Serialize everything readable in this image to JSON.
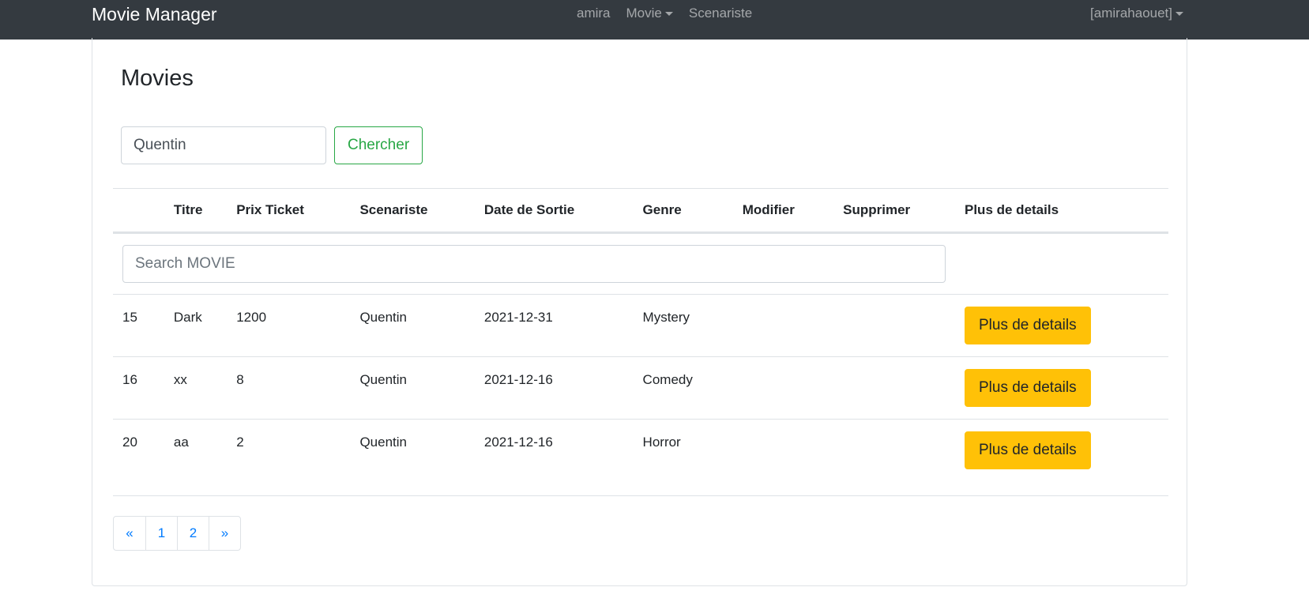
{
  "navbar": {
    "brand": "Movie Manager",
    "links": [
      "amira",
      "Movie",
      "Scenariste"
    ],
    "user": "[amirahaouet]"
  },
  "page": {
    "title": "Movies"
  },
  "search": {
    "value": "Quentin",
    "button_label": "Chercher"
  },
  "table": {
    "headers": [
      "",
      "Titre",
      "Prix Ticket",
      "Scenariste",
      "Date de Sortie",
      "Genre",
      "Modifier",
      "Supprimer",
      "Plus de details"
    ],
    "filter_placeholder": "Search MOVIE",
    "rows": [
      {
        "id": "15",
        "titre": "Dark",
        "prix": "1200",
        "scenariste": "Quentin",
        "date": "2021-12-31",
        "genre": "Mystery",
        "details_label": "Plus de details"
      },
      {
        "id": "16",
        "titre": "xx",
        "prix": "8",
        "scenariste": "Quentin",
        "date": "2021-12-16",
        "genre": "Comedy",
        "details_label": "Plus de details"
      },
      {
        "id": "20",
        "titre": "aa",
        "prix": "2",
        "scenariste": "Quentin",
        "date": "2021-12-16",
        "genre": "Horror",
        "details_label": "Plus de details"
      }
    ]
  },
  "pagination": {
    "prev": "«",
    "pages": [
      "1",
      "2"
    ],
    "next": "»"
  },
  "colors": {
    "navbar_bg": "#343a40",
    "success": "#28a745",
    "warning": "#ffc107",
    "link": "#007bff"
  }
}
